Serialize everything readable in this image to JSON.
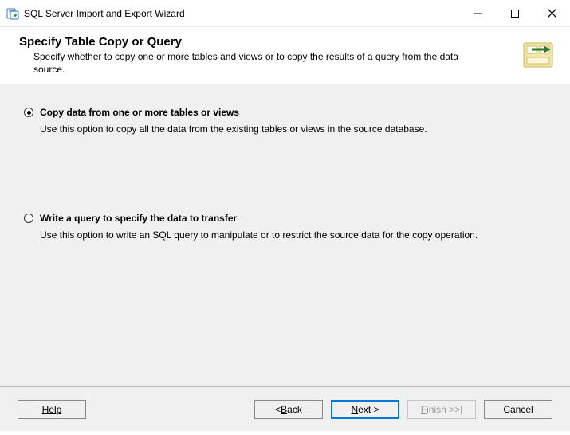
{
  "window": {
    "title": "SQL Server Import and Export Wizard"
  },
  "header": {
    "title": "Specify Table Copy or Query",
    "description": "Specify whether to copy one or more tables and views or to copy the results of a query from the data source."
  },
  "options": {
    "copy": {
      "selected": true,
      "label": "Copy data from one or more tables or views",
      "description": "Use this option to copy all the data from the existing tables or views in the source database."
    },
    "query": {
      "selected": false,
      "label": "Write a query to specify the data to transfer",
      "description": "Use this option to write an SQL query to manipulate or to restrict the source data for the copy operation."
    }
  },
  "buttons": {
    "help": "Help",
    "back_prefix": "< ",
    "back_letter": "B",
    "back_suffix": "ack",
    "next_letter": "N",
    "next_suffix": "ext >",
    "finish_letter": "F",
    "finish_suffix": "inish >>|",
    "cancel": "Cancel"
  }
}
